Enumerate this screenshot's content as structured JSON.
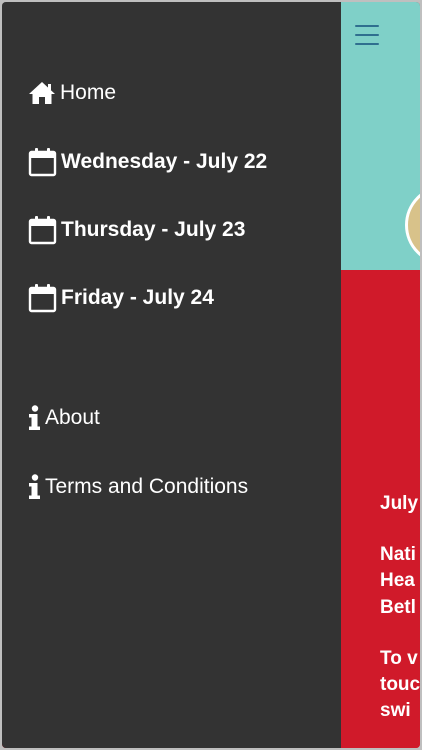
{
  "drawer": {
    "items": [
      {
        "label": "Home",
        "icon": "home-icon"
      },
      {
        "label": "Wednesday - July 22",
        "icon": "calendar-icon"
      },
      {
        "label": "Thursday - July 23",
        "icon": "calendar-icon"
      },
      {
        "label": "Friday - July 24",
        "icon": "calendar-icon"
      },
      {
        "label": "About",
        "icon": "info-icon"
      },
      {
        "label": "Terms and Conditions",
        "icon": "info-icon"
      }
    ]
  },
  "header": {
    "menu_icon": "hamburger-menu-icon"
  },
  "content": {
    "lines": [
      "July",
      "Nati",
      "Hea",
      "Betl",
      "To v",
      "touc",
      "swi"
    ]
  },
  "colors": {
    "drawer_bg": "#333333",
    "header_bg": "#7fd0c8",
    "content_bg": "#d01a2a",
    "menu_icon": "#2f6f8f",
    "text": "#ffffff"
  }
}
